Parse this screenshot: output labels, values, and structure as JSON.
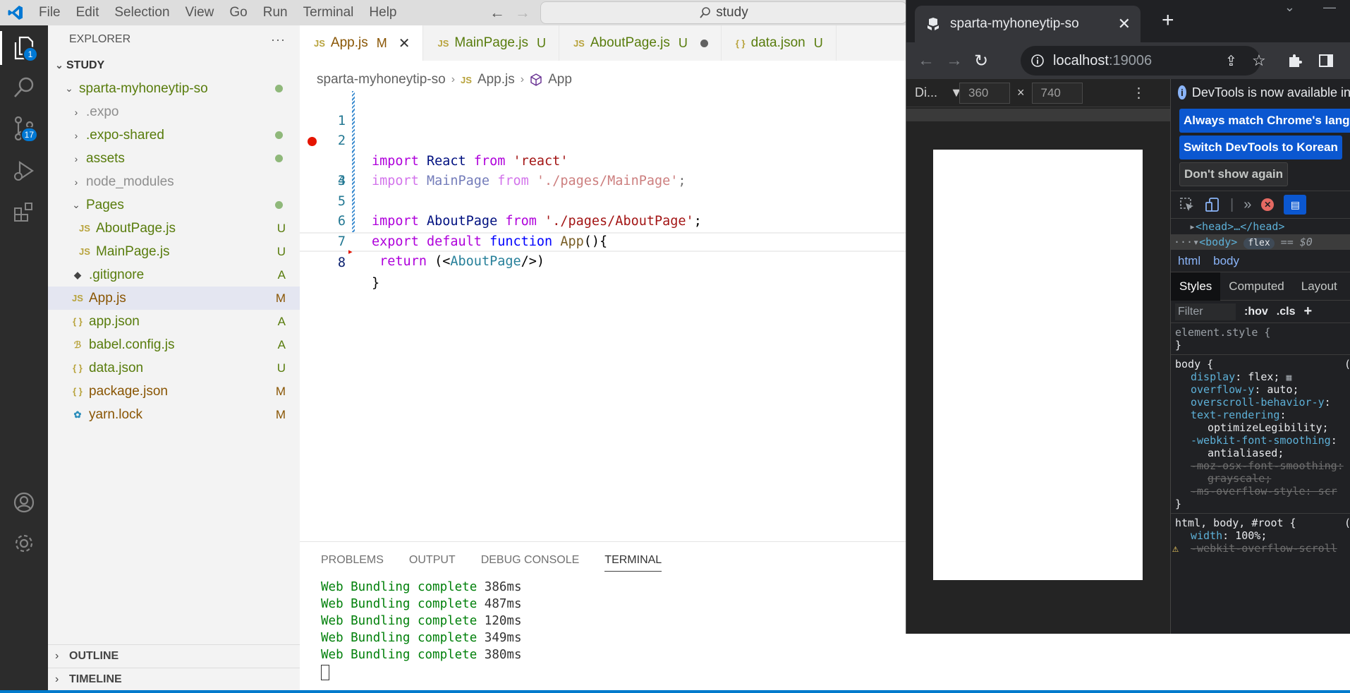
{
  "titlebar": {
    "menu": [
      "File",
      "Edit",
      "Selection",
      "View",
      "Go",
      "Run",
      "Terminal",
      "Help"
    ],
    "search_text": "study"
  },
  "activitybar": {
    "explorer_badge": "1",
    "scm_badge": "17"
  },
  "sidebar": {
    "title": "EXPLORER",
    "more": "···",
    "root": "STUDY",
    "tree": [
      {
        "label": "sparta-myhoneytip-so",
        "kind": "folder-open",
        "level": 1,
        "status": "",
        "dot": true,
        "color": "green"
      },
      {
        "label": ".expo",
        "kind": "folder",
        "level": 2,
        "status": "",
        "dot": false,
        "color": "gray"
      },
      {
        "label": ".expo-shared",
        "kind": "folder",
        "level": 2,
        "status": "",
        "dot": true,
        "color": "green"
      },
      {
        "label": "assets",
        "kind": "folder",
        "level": 2,
        "status": "",
        "dot": true,
        "color": "green"
      },
      {
        "label": "node_modules",
        "kind": "folder",
        "level": 2,
        "status": "",
        "dot": false,
        "color": "gray"
      },
      {
        "label": "Pages",
        "kind": "folder-open",
        "level": 2,
        "status": "",
        "dot": true,
        "color": "green"
      },
      {
        "label": "AboutPage.js",
        "kind": "js",
        "level": 3,
        "status": "U",
        "dot": false,
        "color": "green"
      },
      {
        "label": "MainPage.js",
        "kind": "js",
        "level": 3,
        "status": "U",
        "dot": false,
        "color": "green"
      },
      {
        "label": ".gitignore",
        "kind": "git",
        "level": 2,
        "status": "A",
        "dot": false,
        "color": "green"
      },
      {
        "label": "App.js",
        "kind": "js",
        "level": 2,
        "status": "M",
        "dot": false,
        "color": "orange",
        "selected": true
      },
      {
        "label": "app.json",
        "kind": "json",
        "level": 2,
        "status": "A",
        "dot": false,
        "color": "green"
      },
      {
        "label": "babel.config.js",
        "kind": "babel",
        "level": 2,
        "status": "A",
        "dot": false,
        "color": "green"
      },
      {
        "label": "data.json",
        "kind": "json",
        "level": 2,
        "status": "U",
        "dot": false,
        "color": "green"
      },
      {
        "label": "package.json",
        "kind": "json",
        "level": 2,
        "status": "M",
        "dot": false,
        "color": "orange"
      },
      {
        "label": "yarn.lock",
        "kind": "yarn",
        "level": 2,
        "status": "M",
        "dot": false,
        "color": "orange"
      }
    ],
    "outline": "OUTLINE",
    "timeline": "TIMELINE"
  },
  "tabs": [
    {
      "icon": "JS",
      "label": "App.js",
      "status": "M",
      "state": "close",
      "active": true,
      "color": "orange"
    },
    {
      "icon": "JS",
      "label": "MainPage.js",
      "status": "U",
      "state": "",
      "active": false,
      "color": "green"
    },
    {
      "icon": "JS",
      "label": "AboutPage.js",
      "status": "U",
      "state": "dirty",
      "active": false,
      "color": "green"
    },
    {
      "icon": "{ }",
      "label": "data.json",
      "status": "U",
      "state": "",
      "active": false,
      "color": "green"
    }
  ],
  "breadcrumb": {
    "folder": "sparta-myhoneytip-so",
    "file_icon": "JS",
    "file": "App.js",
    "symbol": "App"
  },
  "code": {
    "line_numbers": [
      "1",
      "2",
      "3",
      "4",
      "5",
      "6",
      "7",
      "8"
    ],
    "l1": {
      "a": "import",
      "b": " React ",
      "c": "from",
      "d": " 'react'"
    },
    "l2": {
      "a": "import",
      "b": " MainPage ",
      "c": "from",
      "d": " './pages/MainPage'",
      "e": ";"
    },
    "l3": {
      "a": "import",
      "b": " AboutPage ",
      "c": "from",
      "d": " './pages/AboutPage'",
      "e": ";"
    },
    "l5": {
      "a": "export",
      "b": " default",
      "c": " function",
      "d": " App",
      "e": "(){"
    },
    "l6": {
      "a": " return",
      "b": " (<",
      "c": "AboutPage",
      "d": "/>)"
    },
    "l8": {
      "a": "}"
    }
  },
  "panel": {
    "tabs": [
      "PROBLEMS",
      "OUTPUT",
      "DEBUG CONSOLE",
      "TERMINAL"
    ],
    "terminal_lines": [
      {
        "text": "Web Bundling complete",
        "ms": " 386ms"
      },
      {
        "text": "Web Bundling complete",
        "ms": " 487ms"
      },
      {
        "text": "Web Bundling complete",
        "ms": " 120ms"
      },
      {
        "text": "Web Bundling complete",
        "ms": " 349ms"
      },
      {
        "text": "Web Bundling complete",
        "ms": " 380ms"
      }
    ]
  },
  "chrome": {
    "tab_title": "sparta-myhoneytip-so",
    "url_host": "localhost",
    "url_port": ":19006",
    "device_label": "Di...",
    "width": "360",
    "height": "740",
    "times": "×"
  },
  "devtools": {
    "info": "DevTools is now available in",
    "btn_match": "Always match Chrome's langu",
    "btn_korean": "Switch DevTools to Korean",
    "btn_dont": "Don't show again",
    "dom_head": "<head>…</head>",
    "dom_body": "<body>",
    "dom_flex": "flex",
    "dom_eq": " == $0",
    "crumbs": [
      "html",
      "body"
    ],
    "tabs": [
      "Styles",
      "Computed",
      "Layout"
    ],
    "filter": "Filter",
    "hov": ":hov",
    "cls": ".cls",
    "plus": "+",
    "element_style": "element.style {",
    "close_brace": "}",
    "body_sel": "body {",
    "body_props": [
      {
        "name": "display",
        "value": ": flex;"
      },
      {
        "name": "overflow-y",
        "value": ": auto;"
      },
      {
        "name": "overscroll-behavior-y",
        "value": ":"
      },
      {
        "name": "text-rendering",
        "value": ":"
      },
      {
        "name": "",
        "value": "optimizeLegibility;"
      },
      {
        "name": "-webkit-font-smoothing",
        "value": ":"
      },
      {
        "name": "",
        "value": "antialiased;"
      }
    ],
    "struck": [
      "-moz-osx-font-smoothing:",
      "grayscale;",
      "-ms-overflow-style: scr"
    ],
    "html_sel": "html, body, #root {",
    "width_prop": "width",
    "width_val": ": 100%;",
    "webkit_scroll": "-webkit-overflow-scroll"
  }
}
